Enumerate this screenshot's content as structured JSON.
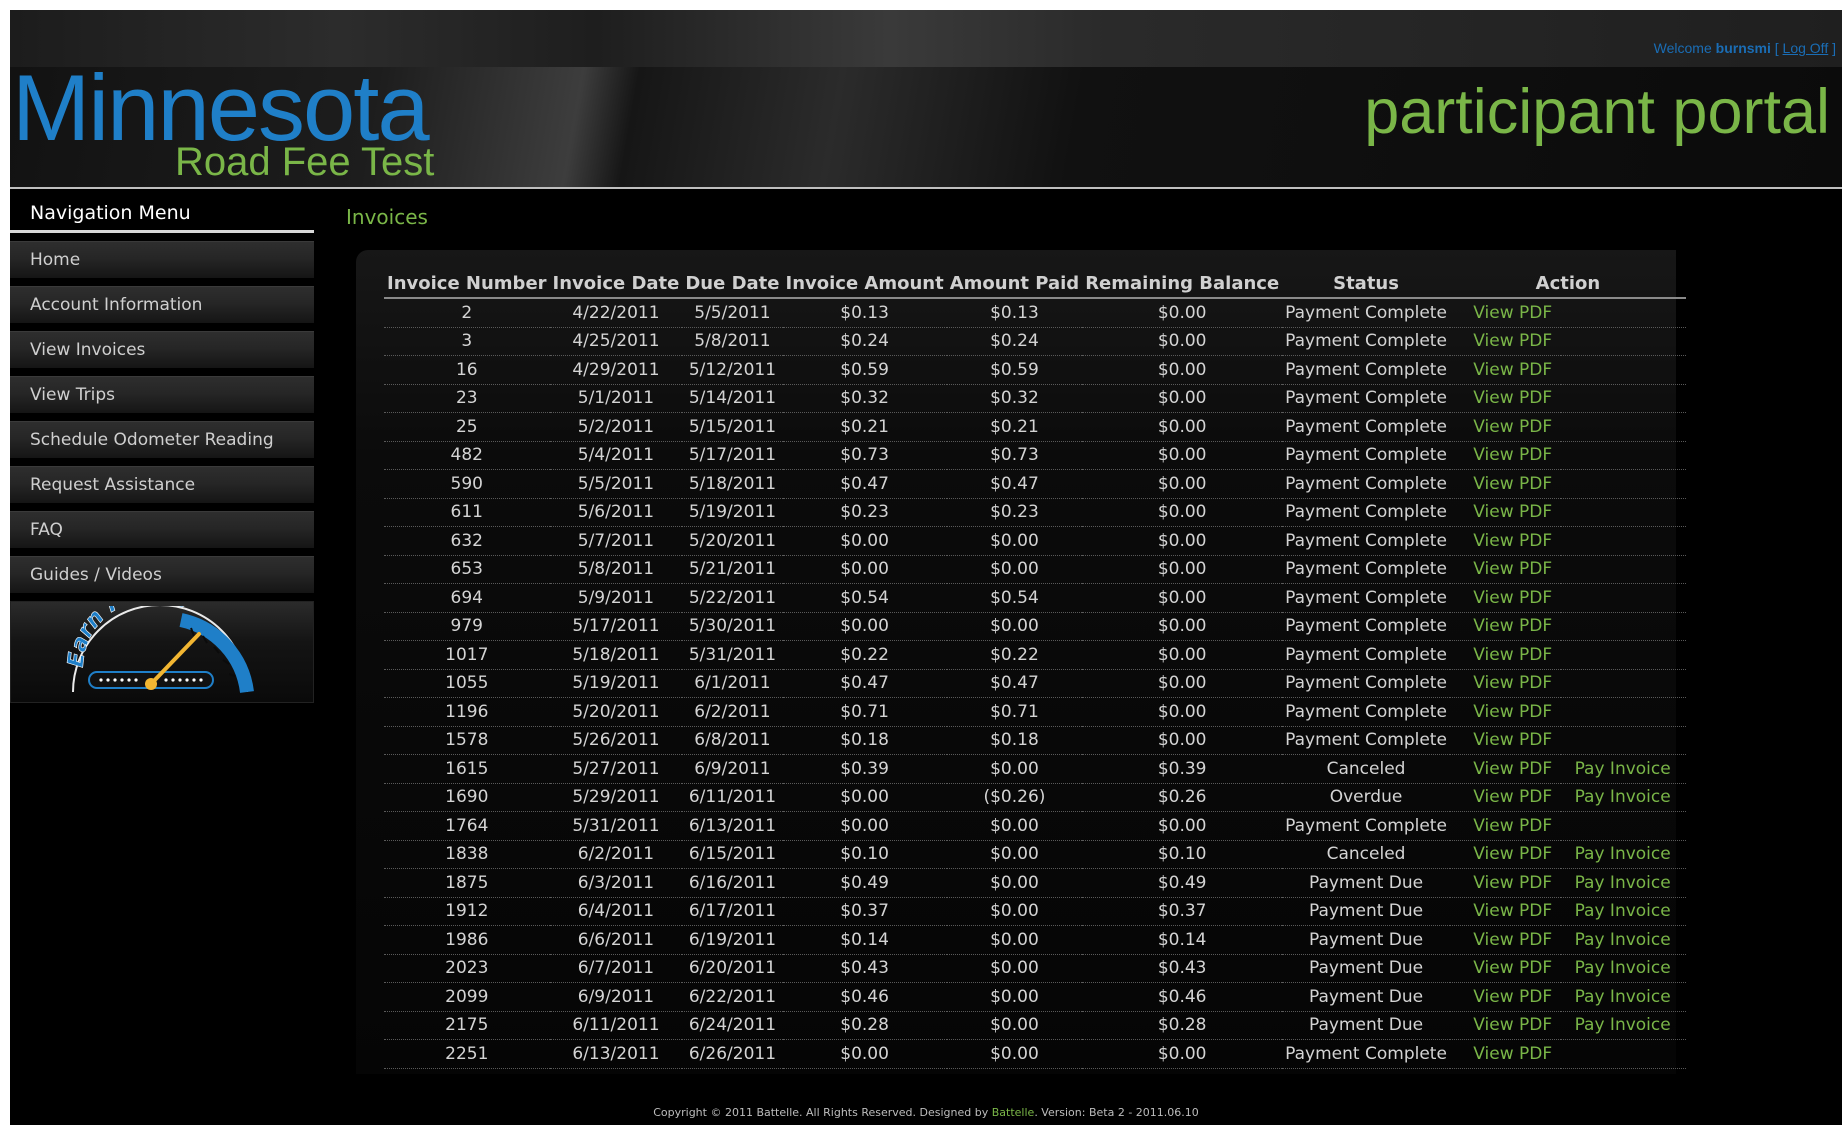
{
  "topbar": {
    "welcome_prefix": "Welcome",
    "username": "burnsmi",
    "bracket_open": "[",
    "logoff": "Log Off",
    "bracket_close": "]"
  },
  "header": {
    "logo_main": "Minnesota",
    "logo_sub": "Road Fee Test",
    "portal_title": "participant portal"
  },
  "sidebar": {
    "title": "Navigation Menu",
    "items": [
      {
        "label": "Home"
      },
      {
        "label": "Account Information"
      },
      {
        "label": "View Invoices"
      },
      {
        "label": "View Trips"
      },
      {
        "label": "Schedule Odometer Reading"
      },
      {
        "label": "Request Assistance"
      },
      {
        "label": "FAQ"
      },
      {
        "label": "Guides / Videos"
      }
    ],
    "earn_points": "Earn Points"
  },
  "main": {
    "heading": "Invoices",
    "columns": [
      "Invoice Number",
      "Invoice Date",
      "Due Date",
      "Invoice Amount",
      "Amount Paid",
      "Remaining Balance",
      "Status",
      "Action"
    ],
    "rows": [
      {
        "num": "2",
        "date": "4/22/2011",
        "due": "5/5/2011",
        "amount": "$0.13",
        "paid": "$0.13",
        "balance": "$0.00",
        "status": "Payment Complete",
        "view": "View PDF",
        "pay": ""
      },
      {
        "num": "3",
        "date": "4/25/2011",
        "due": "5/8/2011",
        "amount": "$0.24",
        "paid": "$0.24",
        "balance": "$0.00",
        "status": "Payment Complete",
        "view": "View PDF",
        "pay": ""
      },
      {
        "num": "16",
        "date": "4/29/2011",
        "due": "5/12/2011",
        "amount": "$0.59",
        "paid": "$0.59",
        "balance": "$0.00",
        "status": "Payment Complete",
        "view": "View PDF",
        "pay": ""
      },
      {
        "num": "23",
        "date": "5/1/2011",
        "due": "5/14/2011",
        "amount": "$0.32",
        "paid": "$0.32",
        "balance": "$0.00",
        "status": "Payment Complete",
        "view": "View PDF",
        "pay": ""
      },
      {
        "num": "25",
        "date": "5/2/2011",
        "due": "5/15/2011",
        "amount": "$0.21",
        "paid": "$0.21",
        "balance": "$0.00",
        "status": "Payment Complete",
        "view": "View PDF",
        "pay": ""
      },
      {
        "num": "482",
        "date": "5/4/2011",
        "due": "5/17/2011",
        "amount": "$0.73",
        "paid": "$0.73",
        "balance": "$0.00",
        "status": "Payment Complete",
        "view": "View PDF",
        "pay": ""
      },
      {
        "num": "590",
        "date": "5/5/2011",
        "due": "5/18/2011",
        "amount": "$0.47",
        "paid": "$0.47",
        "balance": "$0.00",
        "status": "Payment Complete",
        "view": "View PDF",
        "pay": ""
      },
      {
        "num": "611",
        "date": "5/6/2011",
        "due": "5/19/2011",
        "amount": "$0.23",
        "paid": "$0.23",
        "balance": "$0.00",
        "status": "Payment Complete",
        "view": "View PDF",
        "pay": ""
      },
      {
        "num": "632",
        "date": "5/7/2011",
        "due": "5/20/2011",
        "amount": "$0.00",
        "paid": "$0.00",
        "balance": "$0.00",
        "status": "Payment Complete",
        "view": "View PDF",
        "pay": ""
      },
      {
        "num": "653",
        "date": "5/8/2011",
        "due": "5/21/2011",
        "amount": "$0.00",
        "paid": "$0.00",
        "balance": "$0.00",
        "status": "Payment Complete",
        "view": "View PDF",
        "pay": ""
      },
      {
        "num": "694",
        "date": "5/9/2011",
        "due": "5/22/2011",
        "amount": "$0.54",
        "paid": "$0.54",
        "balance": "$0.00",
        "status": "Payment Complete",
        "view": "View PDF",
        "pay": ""
      },
      {
        "num": "979",
        "date": "5/17/2011",
        "due": "5/30/2011",
        "amount": "$0.00",
        "paid": "$0.00",
        "balance": "$0.00",
        "status": "Payment Complete",
        "view": "View PDF",
        "pay": ""
      },
      {
        "num": "1017",
        "date": "5/18/2011",
        "due": "5/31/2011",
        "amount": "$0.22",
        "paid": "$0.22",
        "balance": "$0.00",
        "status": "Payment Complete",
        "view": "View PDF",
        "pay": ""
      },
      {
        "num": "1055",
        "date": "5/19/2011",
        "due": "6/1/2011",
        "amount": "$0.47",
        "paid": "$0.47",
        "balance": "$0.00",
        "status": "Payment Complete",
        "view": "View PDF",
        "pay": ""
      },
      {
        "num": "1196",
        "date": "5/20/2011",
        "due": "6/2/2011",
        "amount": "$0.71",
        "paid": "$0.71",
        "balance": "$0.00",
        "status": "Payment Complete",
        "view": "View PDF",
        "pay": ""
      },
      {
        "num": "1578",
        "date": "5/26/2011",
        "due": "6/8/2011",
        "amount": "$0.18",
        "paid": "$0.18",
        "balance": "$0.00",
        "status": "Payment Complete",
        "view": "View PDF",
        "pay": ""
      },
      {
        "num": "1615",
        "date": "5/27/2011",
        "due": "6/9/2011",
        "amount": "$0.39",
        "paid": "$0.00",
        "balance": "$0.39",
        "status": "Canceled",
        "view": "View PDF",
        "pay": "Pay Invoice"
      },
      {
        "num": "1690",
        "date": "5/29/2011",
        "due": "6/11/2011",
        "amount": "$0.00",
        "paid": "($0.26)",
        "balance": "$0.26",
        "status": "Overdue",
        "view": "View PDF",
        "pay": "Pay Invoice"
      },
      {
        "num": "1764",
        "date": "5/31/2011",
        "due": "6/13/2011",
        "amount": "$0.00",
        "paid": "$0.00",
        "balance": "$0.00",
        "status": "Payment Complete",
        "view": "View PDF",
        "pay": ""
      },
      {
        "num": "1838",
        "date": "6/2/2011",
        "due": "6/15/2011",
        "amount": "$0.10",
        "paid": "$0.00",
        "balance": "$0.10",
        "status": "Canceled",
        "view": "View PDF",
        "pay": "Pay Invoice"
      },
      {
        "num": "1875",
        "date": "6/3/2011",
        "due": "6/16/2011",
        "amount": "$0.49",
        "paid": "$0.00",
        "balance": "$0.49",
        "status": "Payment Due",
        "view": "View PDF",
        "pay": "Pay Invoice"
      },
      {
        "num": "1912",
        "date": "6/4/2011",
        "due": "6/17/2011",
        "amount": "$0.37",
        "paid": "$0.00",
        "balance": "$0.37",
        "status": "Payment Due",
        "view": "View PDF",
        "pay": "Pay Invoice"
      },
      {
        "num": "1986",
        "date": "6/6/2011",
        "due": "6/19/2011",
        "amount": "$0.14",
        "paid": "$0.00",
        "balance": "$0.14",
        "status": "Payment Due",
        "view": "View PDF",
        "pay": "Pay Invoice"
      },
      {
        "num": "2023",
        "date": "6/7/2011",
        "due": "6/20/2011",
        "amount": "$0.43",
        "paid": "$0.00",
        "balance": "$0.43",
        "status": "Payment Due",
        "view": "View PDF",
        "pay": "Pay Invoice"
      },
      {
        "num": "2099",
        "date": "6/9/2011",
        "due": "6/22/2011",
        "amount": "$0.46",
        "paid": "$0.00",
        "balance": "$0.46",
        "status": "Payment Due",
        "view": "View PDF",
        "pay": "Pay Invoice"
      },
      {
        "num": "2175",
        "date": "6/11/2011",
        "due": "6/24/2011",
        "amount": "$0.28",
        "paid": "$0.00",
        "balance": "$0.28",
        "status": "Payment Due",
        "view": "View PDF",
        "pay": "Pay Invoice"
      },
      {
        "num": "2251",
        "date": "6/13/2011",
        "due": "6/26/2011",
        "amount": "$0.00",
        "paid": "$0.00",
        "balance": "$0.00",
        "status": "Payment Complete",
        "view": "View PDF",
        "pay": ""
      }
    ]
  },
  "footer": {
    "text_before": "Copyright © 2011 Battelle. All Rights Reserved. Designed by",
    "company": "Battelle",
    "text_after": ". Version: Beta 2 - 2011.06.10"
  },
  "colors": {
    "accent_green": "#7ab648",
    "logo_blue": "#1f7fc8",
    "background": "#000000"
  },
  "icons": {
    "earn_points": "speedometer-gauge-icon"
  }
}
